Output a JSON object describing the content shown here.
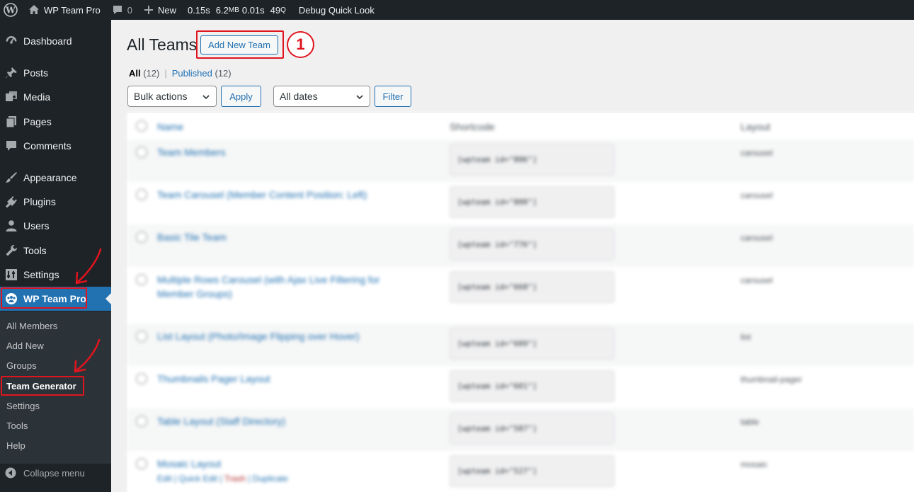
{
  "adminbar": {
    "site_name": "WP Team Pro",
    "comments_count": "0",
    "new_label": "New",
    "qm_time": "0.15s",
    "qm_memory": "6.2",
    "qm_memory_unit": "MB",
    "qm_db_time": "0.01s",
    "qm_queries": "49",
    "qm_queries_unit": "Q",
    "debug_label": "Debug Quick Look"
  },
  "sidebar": {
    "items": [
      {
        "label": "Dashboard",
        "icon": "dashboard-icon"
      },
      {
        "label": "Posts",
        "icon": "pin-icon"
      },
      {
        "label": "Media",
        "icon": "media-icon"
      },
      {
        "label": "Pages",
        "icon": "page-icon"
      },
      {
        "label": "Comments",
        "icon": "comment-icon"
      },
      {
        "label": "Appearance",
        "icon": "brush-icon"
      },
      {
        "label": "Plugins",
        "icon": "plug-icon"
      },
      {
        "label": "Users",
        "icon": "user-icon"
      },
      {
        "label": "Tools",
        "icon": "wrench-icon"
      },
      {
        "label": "Settings",
        "icon": "sliders-icon"
      },
      {
        "label": "WP Team Pro",
        "icon": "team-icon"
      }
    ],
    "submenu": [
      "All Members",
      "Add New",
      "Groups",
      "Team Generator",
      "Settings",
      "Tools",
      "Help"
    ],
    "collapse_label": "Collapse menu"
  },
  "main": {
    "title": "All Teams",
    "add_new_label": "Add New Team",
    "step_number": "1",
    "filters": {
      "all_label": "All",
      "all_count": "(12)",
      "separator": "|",
      "published_label": "Published",
      "published_count": "(12)"
    },
    "bulk_actions": "Bulk actions",
    "apply_label": "Apply",
    "dates": "All dates",
    "filter_label": "Filter"
  },
  "table": {
    "columns": [
      "Name",
      "Shortcode",
      "Layout"
    ],
    "rows": [
      {
        "title": "Team Members",
        "shortcode": "[wpteam id=\"806\"]",
        "layout": "carousel"
      },
      {
        "title": "Team Carousel (Member Content Position: Left)",
        "shortcode": "[wpteam id=\"800\"]",
        "layout": "carousel"
      },
      {
        "title": "Basic Tile Team",
        "shortcode": "[wpteam id=\"776\"]",
        "layout": "carousel"
      },
      {
        "title": "Multiple Rows Carousel (with Ajax Live Filtering for Member Groups)",
        "shortcode": "[wpteam id=\"668\"]",
        "layout": "carousel"
      },
      {
        "title": "List Layout (Photo/Image Flipping over Hover)",
        "shortcode": "[wpteam id=\"609\"]",
        "layout": "list"
      },
      {
        "title": "Thumbnails Pager Layout",
        "shortcode": "[wpteam id=\"601\"]",
        "layout": "thumbnail-pager"
      },
      {
        "title": "Table Layout (Staff Directory)",
        "shortcode": "[wpteam id=\"587\"]",
        "layout": "table"
      },
      {
        "title": "Mosaic Layout",
        "shortcode": "[wpteam id=\"527\"]",
        "layout": "mosaic"
      }
    ],
    "row_actions": [
      "Edit",
      "Quick Edit",
      "Trash",
      "Duplicate"
    ]
  },
  "colors": {
    "admin_dark": "#1d2327",
    "accent": "#2271b1",
    "highlight": "#e0141e"
  }
}
